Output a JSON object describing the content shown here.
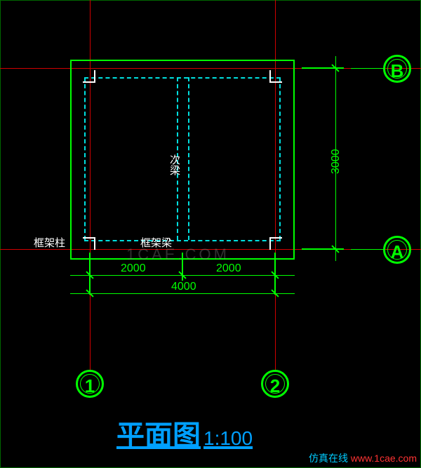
{
  "axes": {
    "A": "A",
    "B": "B",
    "1": "1",
    "2": "2"
  },
  "dimensions": {
    "half1": "2000",
    "half2": "2000",
    "width": "4000",
    "height": "3000"
  },
  "labels": {
    "frame_column": "框架柱",
    "frame_beam": "框架梁",
    "secondary_beam": "次梁"
  },
  "title": {
    "text": "平面图",
    "scale": "1:100"
  },
  "watermark": "1CAE.COM",
  "footer": {
    "brand": "仿真在线",
    "url": "www.1cae.com"
  }
}
